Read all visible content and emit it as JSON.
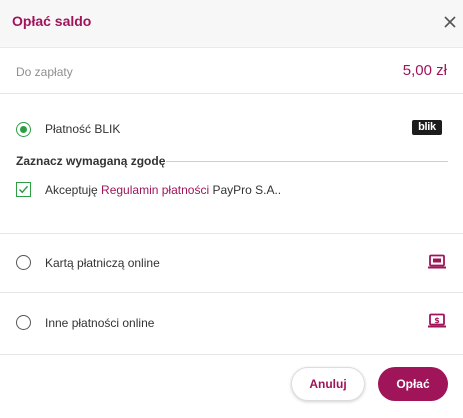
{
  "dialog": {
    "title": "Opłać saldo",
    "close_icon": "close-icon"
  },
  "amount": {
    "label": "Do zapłaty",
    "value": "5,00 zł"
  },
  "payment_methods": [
    {
      "label": "Płatność BLIK",
      "selected": true,
      "icon": "blik-logo",
      "logo_text": "blik"
    },
    {
      "label": "Kartą płatniczą online",
      "selected": false,
      "icon": "laptop-card-icon"
    },
    {
      "label": "Inne płatności online",
      "selected": false,
      "icon": "laptop-dollar-icon"
    }
  ],
  "consent": {
    "title": "Zaznacz wymaganą zgodę",
    "checked": true,
    "text_before": "Akceptuję ",
    "link_text": "Regulamin płatności",
    "text_after": " PayPro S.A.."
  },
  "footer": {
    "cancel_label": "Anuluj",
    "pay_label": "Opłać"
  },
  "colors": {
    "accent": "#a0145a",
    "selected": "#2e9e44"
  }
}
